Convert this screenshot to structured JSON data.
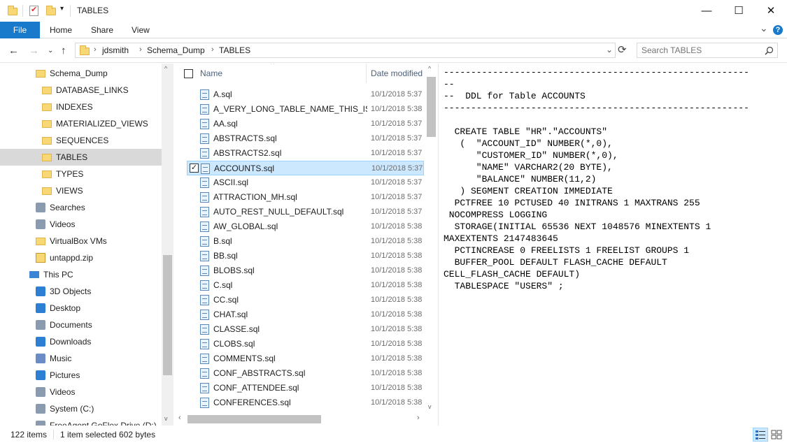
{
  "window": {
    "title": "TABLES",
    "controls": {
      "minimize": "—",
      "maximize": "☐",
      "close": "✕"
    }
  },
  "ribbon": {
    "tabs": [
      {
        "label": "File",
        "active": true
      },
      {
        "label": "Home"
      },
      {
        "label": "Share"
      },
      {
        "label": "View"
      }
    ],
    "collapse_glyph": "⌄",
    "help_glyph": "?"
  },
  "address": {
    "breadcrumbs": [
      "jdsmith",
      "Schema_Dump",
      "TABLES"
    ],
    "search_placeholder": "Search TABLES",
    "sep": "›",
    "dropdown_glyph": "⌄",
    "refresh_glyph": "⟳"
  },
  "nav": {
    "items": [
      {
        "label": "Schema_Dump",
        "icon": "folder-icon",
        "indent": 1
      },
      {
        "label": "DATABASE_LINKS",
        "icon": "folder-icon",
        "indent": 2
      },
      {
        "label": "INDEXES",
        "icon": "folder-icon",
        "indent": 2
      },
      {
        "label": "MATERIALIZED_VIEWS",
        "icon": "folder-icon",
        "indent": 2
      },
      {
        "label": "SEQUENCES",
        "icon": "folder-icon",
        "indent": 2
      },
      {
        "label": "TABLES",
        "icon": "folder-icon",
        "indent": 2,
        "selected": true
      },
      {
        "label": "TYPES",
        "icon": "folder-icon",
        "indent": 2
      },
      {
        "label": "VIEWS",
        "icon": "folder-icon",
        "indent": 2
      },
      {
        "label": "Searches",
        "icon": "searches-icon",
        "indent": 1
      },
      {
        "label": "Videos",
        "icon": "videos-icon",
        "indent": 1
      },
      {
        "label": "VirtualBox VMs",
        "icon": "folder-icon",
        "indent": 1
      },
      {
        "label": "untappd.zip",
        "icon": "zip-icon",
        "indent": 1
      },
      {
        "label": "This PC",
        "icon": "pc-icon",
        "indent": 0
      },
      {
        "label": "3D Objects",
        "icon": "3d-objects-icon",
        "indent": 1
      },
      {
        "label": "Desktop",
        "icon": "desktop-icon",
        "indent": 1
      },
      {
        "label": "Documents",
        "icon": "documents-icon",
        "indent": 1
      },
      {
        "label": "Downloads",
        "icon": "downloads-icon",
        "indent": 1
      },
      {
        "label": "Music",
        "icon": "music-icon",
        "indent": 1
      },
      {
        "label": "Pictures",
        "icon": "pictures-icon",
        "indent": 1
      },
      {
        "label": "Videos",
        "icon": "videos-icon",
        "indent": 1
      },
      {
        "label": "System (C:)",
        "icon": "drive-icon",
        "indent": 1
      },
      {
        "label": "FreeAgent GoFlex Drive (D:)",
        "icon": "drive-icon",
        "indent": 1
      }
    ]
  },
  "filelist": {
    "columns": {
      "name": "Name",
      "date": "Date modified"
    },
    "sort_glyph": "^",
    "files": [
      {
        "name": "A.sql",
        "date": "10/1/2018 5:37"
      },
      {
        "name": "A_VERY_LONG_TABLE_NAME_THIS_IS...",
        "date": "10/1/2018 5:38"
      },
      {
        "name": "AA.sql",
        "date": "10/1/2018 5:37"
      },
      {
        "name": "ABSTRACTS.sql",
        "date": "10/1/2018 5:37"
      },
      {
        "name": "ABSTRACTS2.sql",
        "date": "10/1/2018 5:37"
      },
      {
        "name": "ACCOUNTS.sql",
        "date": "10/1/2018 5:37",
        "selected": true
      },
      {
        "name": "ASCII.sql",
        "date": "10/1/2018 5:37"
      },
      {
        "name": "ATTRACTION_MH.sql",
        "date": "10/1/2018 5:37"
      },
      {
        "name": "AUTO_REST_NULL_DEFAULT.sql",
        "date": "10/1/2018 5:37"
      },
      {
        "name": "AW_GLOBAL.sql",
        "date": "10/1/2018 5:38"
      },
      {
        "name": "B.sql",
        "date": "10/1/2018 5:38"
      },
      {
        "name": "BB.sql",
        "date": "10/1/2018 5:38"
      },
      {
        "name": "BLOBS.sql",
        "date": "10/1/2018 5:38"
      },
      {
        "name": "C.sql",
        "date": "10/1/2018 5:38"
      },
      {
        "name": "CC.sql",
        "date": "10/1/2018 5:38"
      },
      {
        "name": "CHAT.sql",
        "date": "10/1/2018 5:38"
      },
      {
        "name": "CLASSE.sql",
        "date": "10/1/2018 5:38"
      },
      {
        "name": "CLOBS.sql",
        "date": "10/1/2018 5:38"
      },
      {
        "name": "COMMENTS.sql",
        "date": "10/1/2018 5:38"
      },
      {
        "name": "CONF_ABSTRACTS.sql",
        "date": "10/1/2018 5:38"
      },
      {
        "name": "CONF_ATTENDEE.sql",
        "date": "10/1/2018 5:38"
      },
      {
        "name": "CONFERENCES.sql",
        "date": "10/1/2018 5:38"
      }
    ]
  },
  "preview": {
    "text": "--------------------------------------------------------\n--\n--  DDL for Table ACCOUNTS\n--------------------------------------------------------\n\n  CREATE TABLE \"HR\".\"ACCOUNTS\"\n   (  \"ACCOUNT_ID\" NUMBER(*,0),\n      \"CUSTOMER_ID\" NUMBER(*,0),\n      \"NAME\" VARCHAR2(20 BYTE),\n      \"BALANCE\" NUMBER(11,2)\n   ) SEGMENT CREATION IMMEDIATE\n  PCTFREE 10 PCTUSED 40 INITRANS 1 MAXTRANS 255\n NOCOMPRESS LOGGING\n  STORAGE(INITIAL 65536 NEXT 1048576 MINEXTENTS 1\nMAXEXTENTS 2147483645\n  PCTINCREASE 0 FREELISTS 1 FREELIST GROUPS 1\n  BUFFER_POOL DEFAULT FLASH_CACHE DEFAULT\nCELL_FLASH_CACHE DEFAULT)\n  TABLESPACE \"USERS\" ;"
  },
  "status": {
    "count": "122 items",
    "selection": "1 item selected  602 bytes"
  }
}
